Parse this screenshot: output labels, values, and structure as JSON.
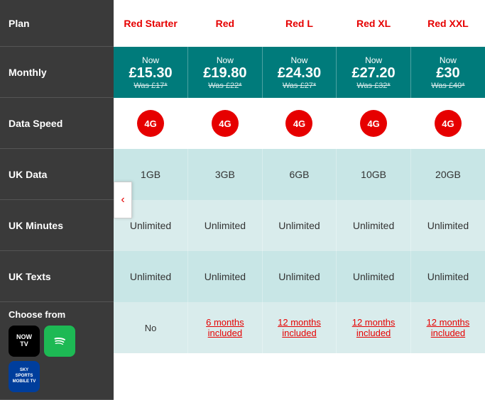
{
  "sidebar": {
    "plan_label": "Plan",
    "monthly_label": "Monthly",
    "data_speed_label": "Data Speed",
    "uk_data_label": "UK Data",
    "uk_minutes_label": "UK Minutes",
    "uk_texts_label": "UK Texts",
    "choose_label": "Choose from"
  },
  "plans": [
    {
      "name": "Red Starter",
      "now": "Now",
      "price": "£15.30",
      "was": "Was £17*",
      "speed": "4G",
      "data": "1GB",
      "minutes": "Unlimited",
      "texts": "Unlimited",
      "extras": "No",
      "extras_link": false
    },
    {
      "name": "Red",
      "now": "Now",
      "price": "£19.80",
      "was": "Was £22*",
      "speed": "4G",
      "data": "3GB",
      "minutes": "Unlimited",
      "texts": "Unlimited",
      "extras": "6 months included",
      "extras_link": true
    },
    {
      "name": "Red L",
      "now": "Now",
      "price": "£24.30",
      "was": "Was £27*",
      "speed": "4G",
      "data": "6GB",
      "minutes": "Unlimited",
      "texts": "Unlimited",
      "extras": "12 months included",
      "extras_link": true
    },
    {
      "name": "Red XL",
      "now": "Now",
      "price": "£27.20",
      "was": "Was £32*",
      "speed": "4G",
      "data": "10GB",
      "minutes": "Unlimited",
      "texts": "Unlimited",
      "extras": "12 months included",
      "extras_link": true
    },
    {
      "name": "Red XXL",
      "now": "Now",
      "price": "£30",
      "was": "Was £40*",
      "speed": "4G",
      "data": "20GB",
      "minutes": "Unlimited",
      "texts": "Unlimited",
      "extras": "12 months included",
      "extras_link": true
    }
  ],
  "nav": {
    "arrow_left": "‹"
  },
  "icons": {
    "nowtv": "NOW TV",
    "spotify": "♫",
    "sky": "SKY SPORTS MOBILE TV"
  }
}
